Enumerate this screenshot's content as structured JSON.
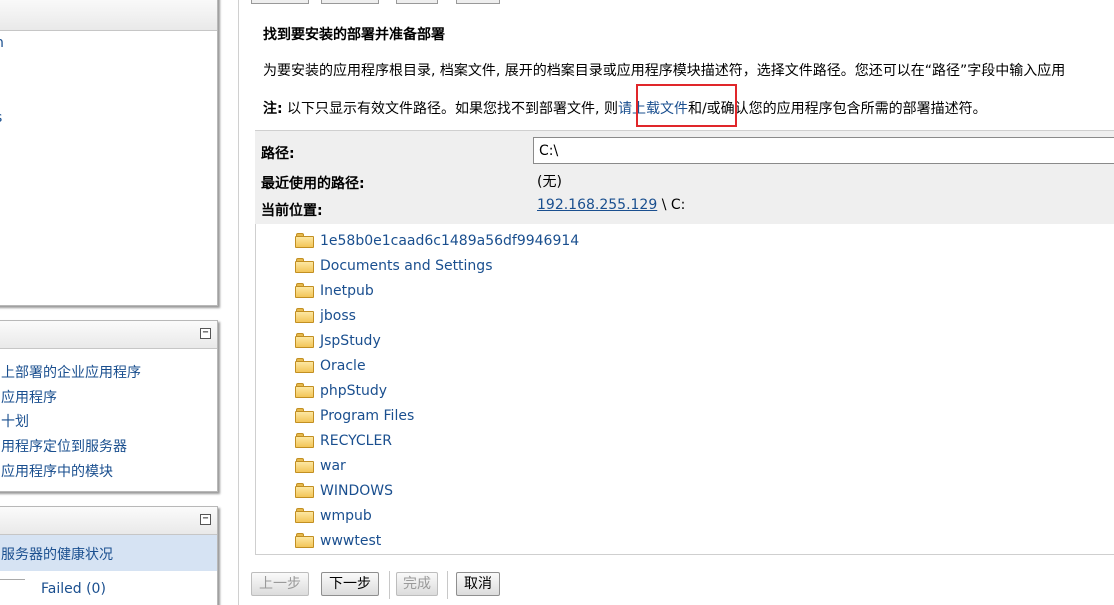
{
  "sidebar": {
    "top_panel_lines": [
      "n",
      "s"
    ],
    "tasks_panel": {
      "collapse_symbol": "⊟",
      "links": [
        "上部署的企业应用程序",
        "应用程序",
        "十划",
        "用程序定位到服务器",
        "应用程序中的模块"
      ]
    },
    "health_panel": {
      "collapse_symbol": "⊟",
      "selected_item": "服务器的健康状况",
      "failed_label": "Failed (0)"
    }
  },
  "main": {
    "title": "找到要安装的部署并准备部署",
    "description": "为要安装的应用程序根目录, 档案文件, 展开的档案目录或应用程序模块描述符，选择文件路径。您还可以在“路径”字段中输入应用",
    "note": {
      "label": "注:",
      "text_before": " 以下只显示有效文件路径。如果您找不到部署文件, 则",
      "link": "请上载文件",
      "text_after": "和/或确认您的应用程序包含所需的部署描述符。"
    },
    "form": {
      "path_label": "路径:",
      "path_value": "C:\\",
      "recent_label": "最近使用的路径:",
      "recent_value": "(无)",
      "location_label": "当前位置:",
      "location_host": "192.168.255.129",
      "location_rest": " \\ C:"
    },
    "folders": [
      "1e58b0e1caad6c1489a56df9946914",
      "Documents and Settings",
      "Inetpub",
      "jboss",
      "JspStudy",
      "Oracle",
      "phpStudy",
      "Program Files",
      "RECYCLER",
      "war",
      "WINDOWS",
      "wmpub",
      "wwwtest"
    ],
    "buttons": {
      "back": "上一步",
      "next": "下一步",
      "finish": "完成",
      "cancel": "取消"
    }
  },
  "colors": {
    "link": "#1a4f8f",
    "highlight_box": "#e0262a",
    "selected_row": "#d6e3f3"
  }
}
